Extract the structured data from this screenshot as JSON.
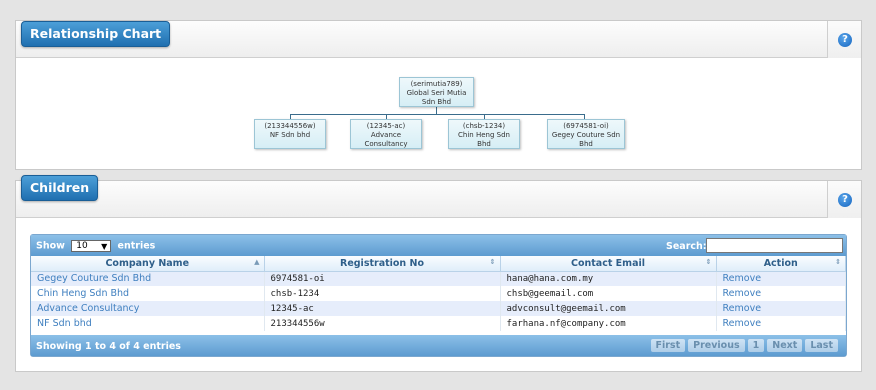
{
  "relationship_panel": {
    "title": "Relationship Chart",
    "help": "?",
    "root": {
      "id": "(serimutia789)",
      "name": "Global Seri Mutia Sdn Bhd"
    },
    "children": [
      {
        "id": "(213344556w)",
        "name": "NF Sdn bhd"
      },
      {
        "id": "(12345-ac)",
        "name": "Advance Consultancy"
      },
      {
        "id": "(chsb-1234)",
        "name": "Chin Heng Sdn Bhd"
      },
      {
        "id": "(6974581-oi)",
        "name": "Gegey Couture Sdn Bhd"
      }
    ]
  },
  "children_panel": {
    "title": "Children",
    "help": "?",
    "show_label": "Show",
    "entries_value": "10",
    "entries_label": "entries",
    "search_label": "Search:",
    "search_value": "",
    "columns": [
      "Company Name",
      "Registration No",
      "Contact Email",
      "Action"
    ],
    "rows": [
      {
        "company": "Gegey Couture Sdn Bhd",
        "reg": "6974581-oi",
        "email": "hana@hana.com.my",
        "action": "Remove"
      },
      {
        "company": "Chin Heng Sdn Bhd",
        "reg": "chsb-1234",
        "email": "chsb@geemail.com",
        "action": "Remove"
      },
      {
        "company": "Advance Consultancy",
        "reg": "12345-ac",
        "email": "advconsult@geemail.com",
        "action": "Remove"
      },
      {
        "company": "NF Sdn bhd",
        "reg": "213344556w",
        "email": "farhana.nf@company.com",
        "action": "Remove"
      }
    ],
    "info": "Showing 1 to 4 of 4 entries",
    "pagination": {
      "first": "First",
      "previous": "Previous",
      "page": "1",
      "next": "Next",
      "last": "Last"
    }
  }
}
